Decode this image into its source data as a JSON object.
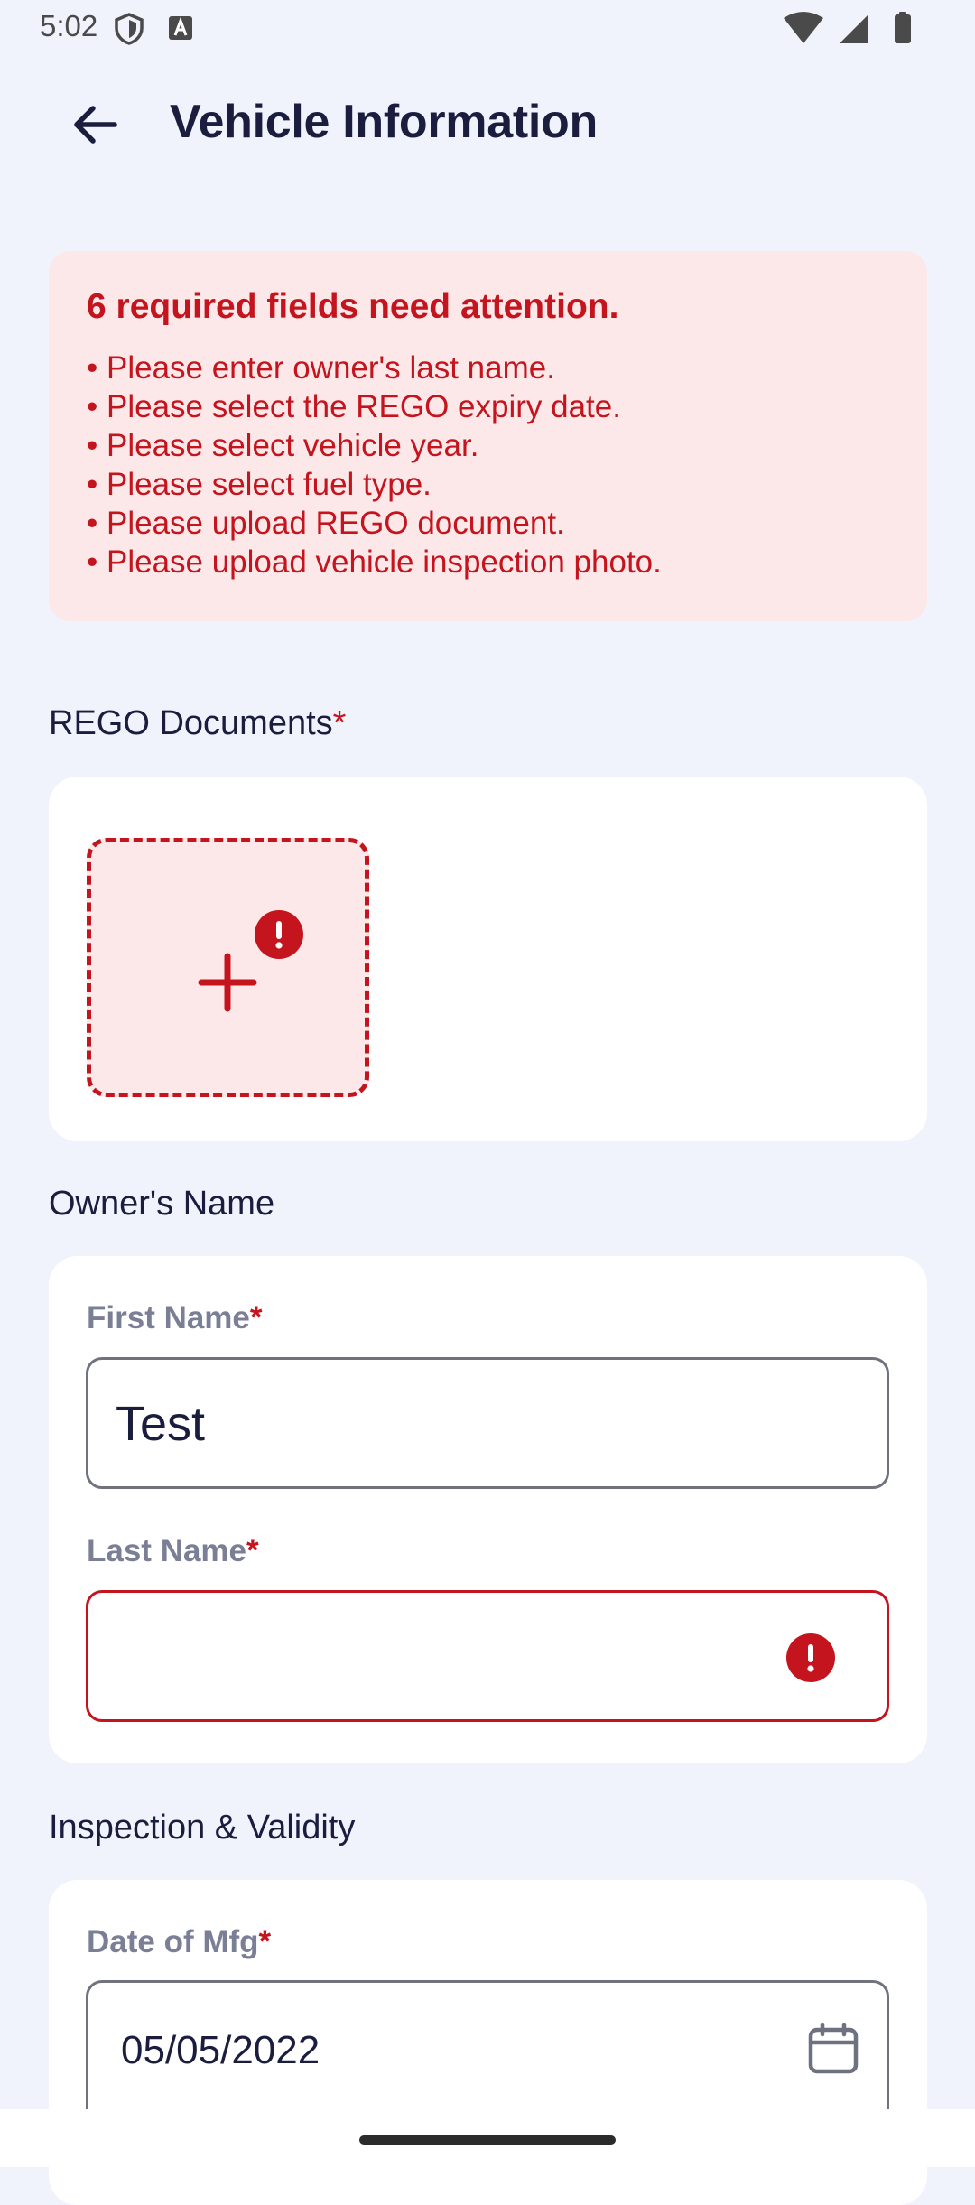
{
  "status_bar": {
    "time": "5:02"
  },
  "app_bar": {
    "title": "Vehicle Information"
  },
  "error_banner": {
    "title": "6 required fields need attention.",
    "items": [
      "• Please enter owner's last name.",
      "• Please select the REGO expiry date.",
      "• Please select vehicle year.",
      "• Please select fuel type.",
      "• Please upload REGO document.",
      "• Please upload vehicle inspection photo."
    ]
  },
  "rego": {
    "label": "REGO Documents",
    "required_mark": "*"
  },
  "owner": {
    "label": "Owner's Name",
    "first_name": {
      "label": "First Name",
      "required_mark": "*",
      "value": "Test"
    },
    "last_name": {
      "label": "Last Name",
      "required_mark": "*",
      "value": ""
    }
  },
  "inspection": {
    "label": "Inspection & Validity",
    "date_of_mfg": {
      "label": "Date of Mfg",
      "required_mark": "*",
      "value": "05/05/2022"
    }
  },
  "colors": {
    "error": "#c4141e",
    "error_bg": "#fde8e9",
    "page_bg": "#f0f3fb",
    "title": "#1b1d3f"
  },
  "icons": [
    "back-arrow-icon",
    "plus-icon",
    "error-icon",
    "calendar-icon"
  ]
}
